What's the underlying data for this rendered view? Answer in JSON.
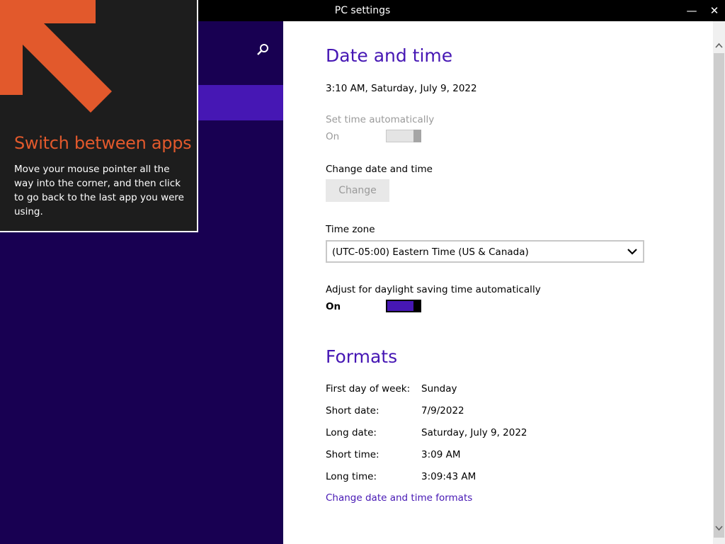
{
  "window": {
    "title": "PC settings",
    "minimize_glyph": "—",
    "close_glyph": "✕"
  },
  "tip": {
    "title": "Switch between apps",
    "body": "Move your mouse pointer all the way into the corner, and then click to go back to the last app you were using.",
    "arrow_color": "#e2592c"
  },
  "date_time": {
    "heading": "Date and time",
    "current": "3:10 AM, Saturday, July 9, 2022",
    "set_auto_label": "Set time automatically",
    "set_auto_state": "On",
    "change_label": "Change date and time",
    "change_button": "Change",
    "timezone_label": "Time zone",
    "timezone_value": "(UTC-05:00) Eastern Time (US & Canada)",
    "dst_label": "Adjust for daylight saving time automatically",
    "dst_state": "On"
  },
  "formats": {
    "heading": "Formats",
    "rows": [
      {
        "label": "First day of week:",
        "value": "Sunday"
      },
      {
        "label": "Short date:",
        "value": "7/9/2022"
      },
      {
        "label": "Long date:",
        "value": "Saturday, July 9, 2022"
      },
      {
        "label": "Short time:",
        "value": "3:09 AM"
      },
      {
        "label": "Long time:",
        "value": "3:09:43 AM"
      }
    ],
    "link": "Change date and time formats"
  },
  "colors": {
    "accent": "#4617b4",
    "nav_bg": "#180052",
    "tip_title": "#e2592c"
  }
}
